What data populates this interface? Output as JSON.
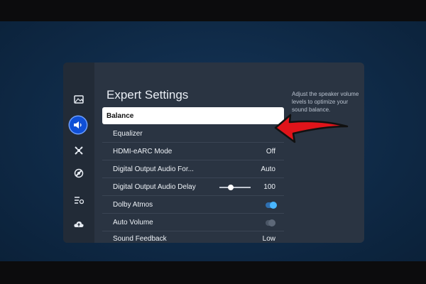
{
  "page": {
    "title": "Expert Settings"
  },
  "description": "Adjust the speaker volume levels to optimize your sound balance.",
  "sidebar": {
    "items": [
      {
        "name": "picture",
        "icon": "picture-icon",
        "active": false
      },
      {
        "name": "sound",
        "icon": "speaker-icon",
        "active": true
      },
      {
        "name": "connection",
        "icon": "connection-icon",
        "active": false
      },
      {
        "name": "support",
        "icon": "support-icon",
        "active": false
      },
      {
        "name": "general",
        "icon": "general-settings-icon",
        "active": false
      },
      {
        "name": "cloud",
        "icon": "cloud-icon",
        "active": false
      }
    ]
  },
  "settings": {
    "items": [
      {
        "label": "Balance",
        "value": ""
      },
      {
        "label": "Equalizer",
        "value": ""
      },
      {
        "label": "HDMI-eARC Mode",
        "value": "Off"
      },
      {
        "label": "Digital Output Audio For...",
        "value": "Auto"
      },
      {
        "label": "Digital Output Audio Delay",
        "value": "100",
        "slider_level": 0.35
      },
      {
        "label": "Dolby Atmos",
        "toggle": "on"
      },
      {
        "label": "Auto Volume",
        "toggle": "off"
      },
      {
        "label": "Sound Feedback",
        "value": "Low"
      }
    ]
  },
  "colors": {
    "accent": "#0f4fd6",
    "focus": "#ffffff",
    "arrow": "#e0141a",
    "panel": "#2a3442"
  }
}
